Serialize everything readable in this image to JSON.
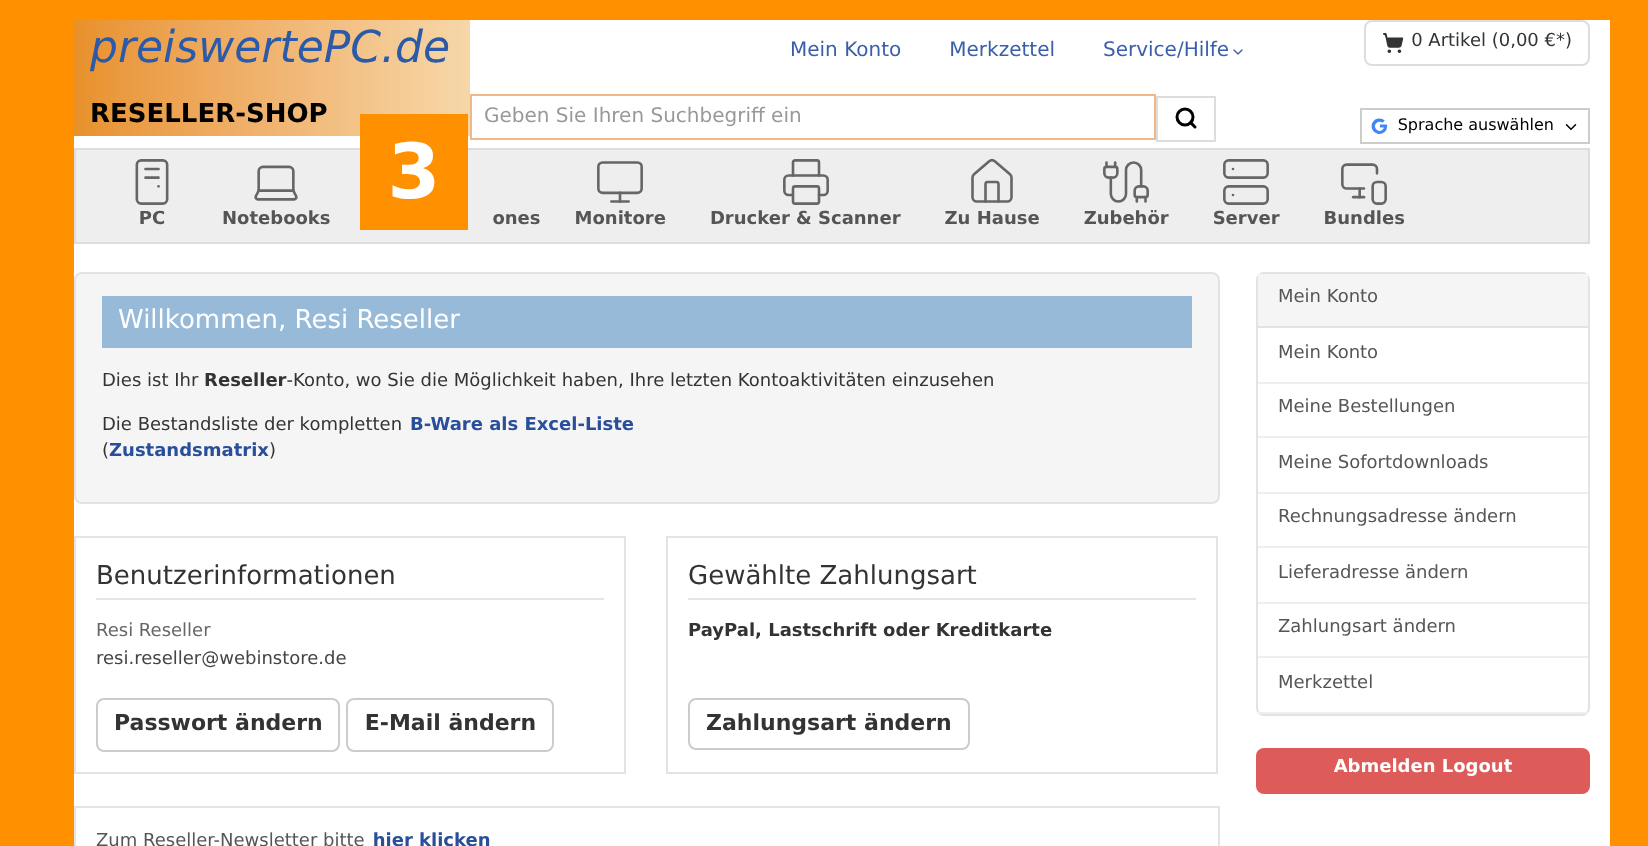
{
  "header": {
    "logo": "preiswertePC.de",
    "shop_label": "RESELLER-SHOP",
    "nav": [
      "Mein Konto",
      "Merkzettel",
      "Service/Hilfe"
    ],
    "cart": "0 Artikel (0,00 €*)",
    "search": {
      "placeholder": "Geben Sie Ihren Suchbegriff ein"
    },
    "translate": "Sprache auswählen",
    "step_badge": "3"
  },
  "categories": [
    {
      "label": "PC",
      "kind": "pc"
    },
    {
      "label": "Notebooks",
      "kind": "notebook"
    },
    {
      "label": "ones",
      "kind": "hidden"
    },
    {
      "label": "Monitore",
      "kind": "monitor"
    },
    {
      "label": "Drucker & Scanner",
      "kind": "printer"
    },
    {
      "label": "Zu Hause",
      "kind": "home"
    },
    {
      "label": "Zubehör",
      "kind": "accessory"
    },
    {
      "label": "Server",
      "kind": "server"
    },
    {
      "label": "Bundles",
      "kind": "bundle"
    }
  ],
  "welcome": {
    "title": "Willkommen, Resi Reseller",
    "intro": "Dies ist Ihr **Reseller**-Konto, wo Sie die Möglichkeit haben, Ihre letzten Kontoaktivitäten einzusehen",
    "stock_text": "Die Bestandsliste der kompletten",
    "stock_link": "B-Ware als Excel-Liste",
    "matrix_open": "(",
    "matrix_link": "Zustandsmatrix",
    "matrix_close": ")"
  },
  "user_info": {
    "title": "Benutzerinformationen",
    "name": "Resi Reseller",
    "email": "resi.reseller@webinstore.de",
    "buttons": [
      "Passwort ändern",
      "E-Mail ändern"
    ]
  },
  "payment": {
    "title": "Gewählte Zahlungsart",
    "method": "PayPal, Lastschrift oder Kreditkarte",
    "button": "Zahlungsart ändern"
  },
  "newsletter": {
    "text": "Zum Reseller-Newsletter bitte",
    "link": "hier klicken"
  },
  "sidebar": {
    "heading": "Mein Konto",
    "items": [
      "Mein Konto",
      "Meine Bestellungen",
      "Meine Sofortdownloads",
      "Rechnungsadresse ändern",
      "Lieferadresse ändern",
      "Zahlungsart ändern",
      "Merkzettel"
    ],
    "logout": "Abmelden Logout"
  }
}
